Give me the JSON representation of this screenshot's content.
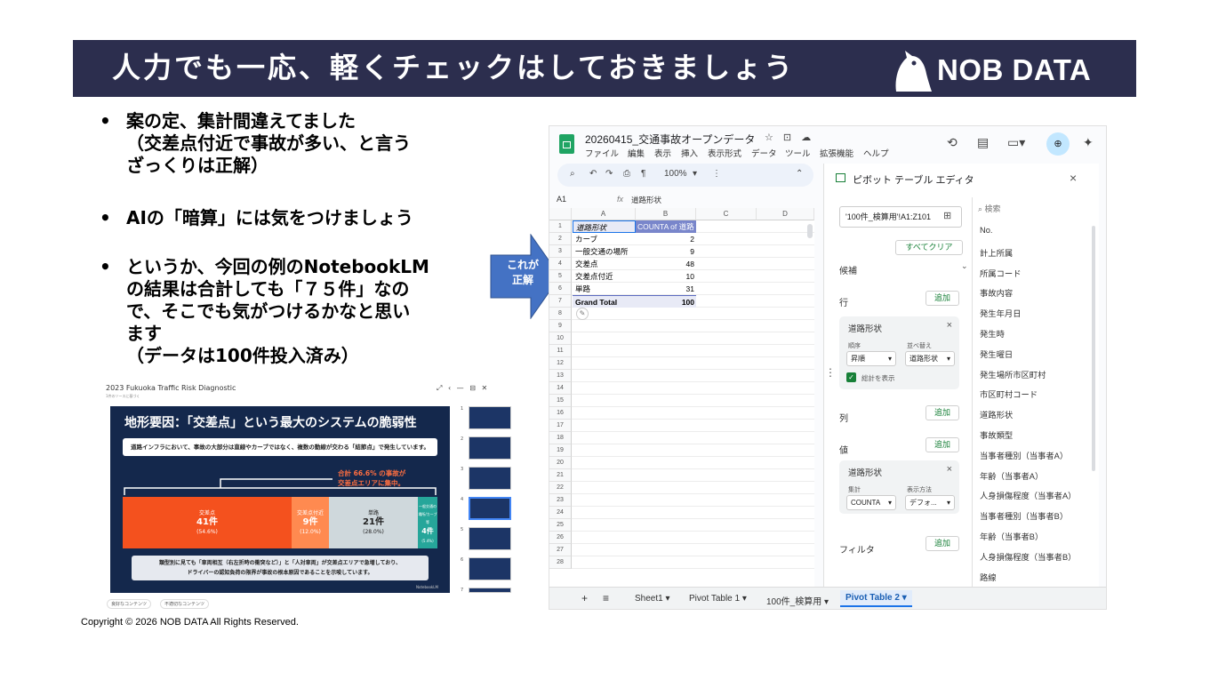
{
  "banner": {
    "title": "人力でも一応、軽くチェックはしておきましょう",
    "logo_text": "NOB DATA"
  },
  "bullets": [
    {
      "marker": "•",
      "lines": [
        "案の定、集計間違えてました",
        "（交差点付近で事故が多い、と言う",
        "ざっくりは正解）"
      ]
    },
    {
      "marker": "•",
      "lines": [
        "AIの「暗算」には気をつけましょう"
      ]
    },
    {
      "marker": "•",
      "lines": [
        "というか、今回の例のNotebookLM",
        "の結果は合計しても「７５件」なの",
        "で、そこでも気がつけるかなと思い",
        "ます",
        "（データは100件投入済み）"
      ]
    }
  ],
  "arrow": {
    "label_line1": "これが",
    "label_line2": "正解",
    "color": "#4472c4"
  },
  "copyright": "Copyright © 2026 NOB DATA All Rights Reserved.",
  "sheets": {
    "doc_title": "20260415_交通事故オープンデータ",
    "title_icons": "☆ ⊡ ☁",
    "menu": [
      "ファイル",
      "編集",
      "表示",
      "挿入",
      "表示形式",
      "データ",
      "ツール",
      "拡張機能",
      "ヘルプ"
    ],
    "toolbar": {
      "zoom": "100%"
    },
    "name_box": "A1",
    "formula": "道路形状",
    "columns": [
      "A",
      "B",
      "C",
      "D"
    ],
    "pivot": {
      "header_a": "道路形状",
      "header_b": "COUNTA of 道路",
      "rows": [
        {
          "label": "カーブ",
          "value": "2"
        },
        {
          "label": "一般交通の場所",
          "value": "9"
        },
        {
          "label": "交差点",
          "value": "48"
        },
        {
          "label": "交差点付近",
          "value": "10"
        },
        {
          "label": "単路",
          "value": "31"
        }
      ],
      "total_label": "Grand Total",
      "total_value": "100"
    },
    "row_numbers": [
      "1",
      "2",
      "3",
      "4",
      "5",
      "6",
      "7",
      "8",
      "9",
      "10",
      "11",
      "12",
      "13",
      "14",
      "15",
      "16",
      "17",
      "18",
      "19",
      "20",
      "21",
      "22",
      "23",
      "24",
      "25",
      "26",
      "27",
      "28"
    ],
    "tabs": [
      "Sheet1",
      "Pivot Table 1",
      "100件_検算用",
      "Pivot Table 2"
    ],
    "tab_plus": "+",
    "tab_menu": "≡"
  },
  "pivot_editor": {
    "title": "ピボット テーブル エディタ",
    "range": "'100件_検算用'!A1:Z101",
    "clear_all": "すべてクリア",
    "suggestions": "候補",
    "rows_label": "行",
    "add": "追加",
    "row_field": {
      "name": "道路形状",
      "order_label": "順序",
      "order_value": "昇順",
      "sort_label": "並べ替え",
      "sort_value": "道路形状",
      "show_total": "総計を表示"
    },
    "columns_label": "列",
    "values_label": "値",
    "value_field": {
      "name": "道路形状",
      "summarize_label": "集計",
      "summarize_value": "COUNTA",
      "display_label": "表示方法",
      "display_value": "デフォ..."
    },
    "filter_label": "フィルタ",
    "search_placeholder": "検索",
    "fields": [
      "No.",
      "計上所属",
      "所属コード",
      "事故内容",
      "発生年月日",
      "発生時",
      "発生曜日",
      "発生場所市区町村",
      "市区町村コード",
      "道路形状",
      "事故類型",
      "当事者種別（当事者A）",
      "年齢（当事者A）",
      "人身損傷程度（当事者A）",
      "当事者種別（当事者B）",
      "年齢（当事者B）",
      "人身損傷程度（当事者B）",
      "路線"
    ]
  },
  "notebook": {
    "title": "2023 Fukuoka Traffic Risk Diagnostic",
    "subtitle": "1件のソースに基づく",
    "slide_title": "地形要因：「交差点」という最大のシステムの脆弱性",
    "slide_box": "道路インフラにおいて、事故の大部分は直線やカーブではなく、複数の動線が交わる「結節点」で発生しています。",
    "callout_line1": "合計 66.6% の事故が",
    "callout_line2": "交差点エリアに集中。",
    "segments": [
      {
        "label": "交差点",
        "count": "41件",
        "pct": "(54.6%)",
        "color": "#f4511e"
      },
      {
        "label": "交差点付近",
        "count": "9件",
        "pct": "(12.0%)",
        "color": "#ff8a50"
      },
      {
        "label": "単路",
        "count": "21件",
        "pct": "(28.0%)",
        "color": "#cfd8dc"
      },
      {
        "label": "一般交通の場所/カーブ等",
        "count": "4件",
        "pct": "(5.4%)",
        "color": "#26a69a"
      }
    ],
    "note_line1": "類型別に見ても「車両相互（右左折時の衝突など）」と「人対車両」が交差点エリアで急増しており、",
    "note_line2": "ドライバーの認知負荷の限界が事故の根本原因であることを示唆しています。",
    "credit": "NotebookLM",
    "thumb_numbers": [
      "1",
      "2",
      "3",
      "4",
      "5",
      "6",
      "7"
    ],
    "btn_good": "良好なコンテンツ",
    "btn_bad": "不適切なコンテンツ"
  }
}
